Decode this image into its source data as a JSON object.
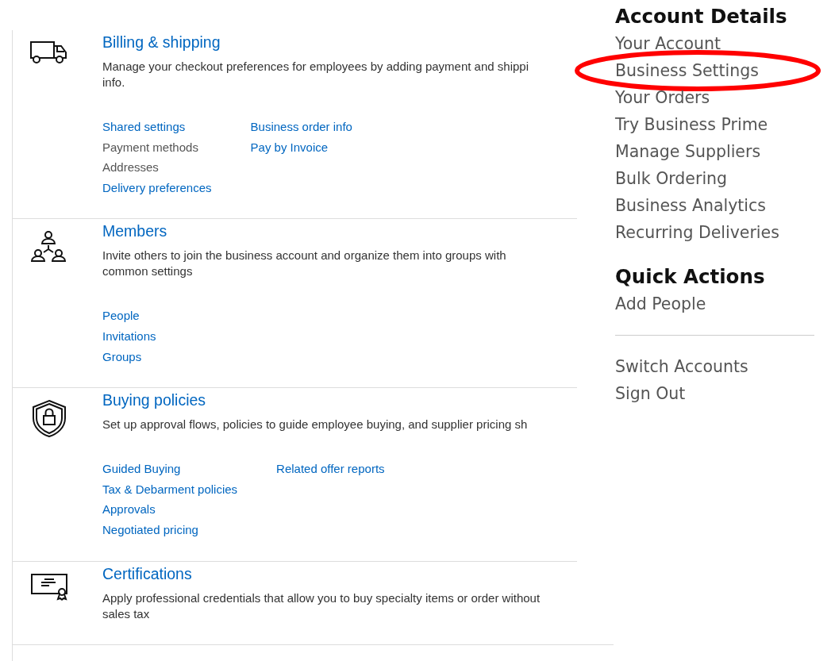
{
  "sections": [
    {
      "kind": "truck",
      "title": "Billing & shipping",
      "description": [
        "Manage your checkout preferences for employees by adding payment and shippi",
        "info."
      ],
      "link_columns": [
        [
          {
            "text": "Shared settings",
            "disabled": false
          },
          {
            "text": "Payment methods",
            "disabled": true
          },
          {
            "text": "Addresses",
            "disabled": true
          },
          {
            "text": "Delivery preferences",
            "disabled": false
          }
        ],
        [
          {
            "text": "Business order info",
            "disabled": false
          },
          {
            "text": "Pay by Invoice",
            "disabled": false
          }
        ]
      ]
    },
    {
      "kind": "people",
      "title": "Members",
      "description": [
        "Invite others to join the business account and organize them into groups with",
        "common settings"
      ],
      "link_columns": [
        [
          {
            "text": "People",
            "disabled": false
          },
          {
            "text": "Invitations",
            "disabled": false
          },
          {
            "text": "Groups",
            "disabled": false
          }
        ]
      ]
    },
    {
      "kind": "shield",
      "title": "Buying policies",
      "description": [
        "Set up approval flows, policies to guide employee buying, and supplier pricing sh"
      ],
      "link_columns": [
        [
          {
            "text": "Guided Buying",
            "disabled": false
          },
          {
            "text": "Tax & Debarment policies",
            "disabled": false
          },
          {
            "text": "Approvals",
            "disabled": false
          },
          {
            "text": "Negotiated pricing",
            "disabled": false
          }
        ],
        [
          {
            "text": "Related offer reports",
            "disabled": false
          }
        ]
      ]
    },
    {
      "kind": "certificate",
      "title": "Certifications",
      "description": [
        "Apply professional credentials that allow you to buy specialty items or order without",
        "sales tax"
      ]
    }
  ],
  "menu": {
    "groups": [
      {
        "heading": "Account Details",
        "items": [
          {
            "text": "Your Account",
            "circled": false
          },
          {
            "text": "Business Settings",
            "circled": true
          },
          {
            "text": "Your Orders",
            "circled": false
          },
          {
            "text": "Try Business Prime",
            "circled": false
          },
          {
            "text": "Manage Suppliers",
            "circled": false
          },
          {
            "text": "Bulk Ordering",
            "circled": false
          },
          {
            "text": "Business Analytics",
            "circled": false
          },
          {
            "text": "Recurring Deliveries",
            "circled": false
          }
        ]
      },
      {
        "heading": "Quick Actions",
        "items": [
          {
            "text": "Add People",
            "circled": false
          }
        ]
      },
      {
        "items": [
          {
            "text": "Switch Accounts",
            "circled": false
          },
          {
            "text": "Sign Out",
            "circled": false
          }
        ]
      }
    ]
  }
}
